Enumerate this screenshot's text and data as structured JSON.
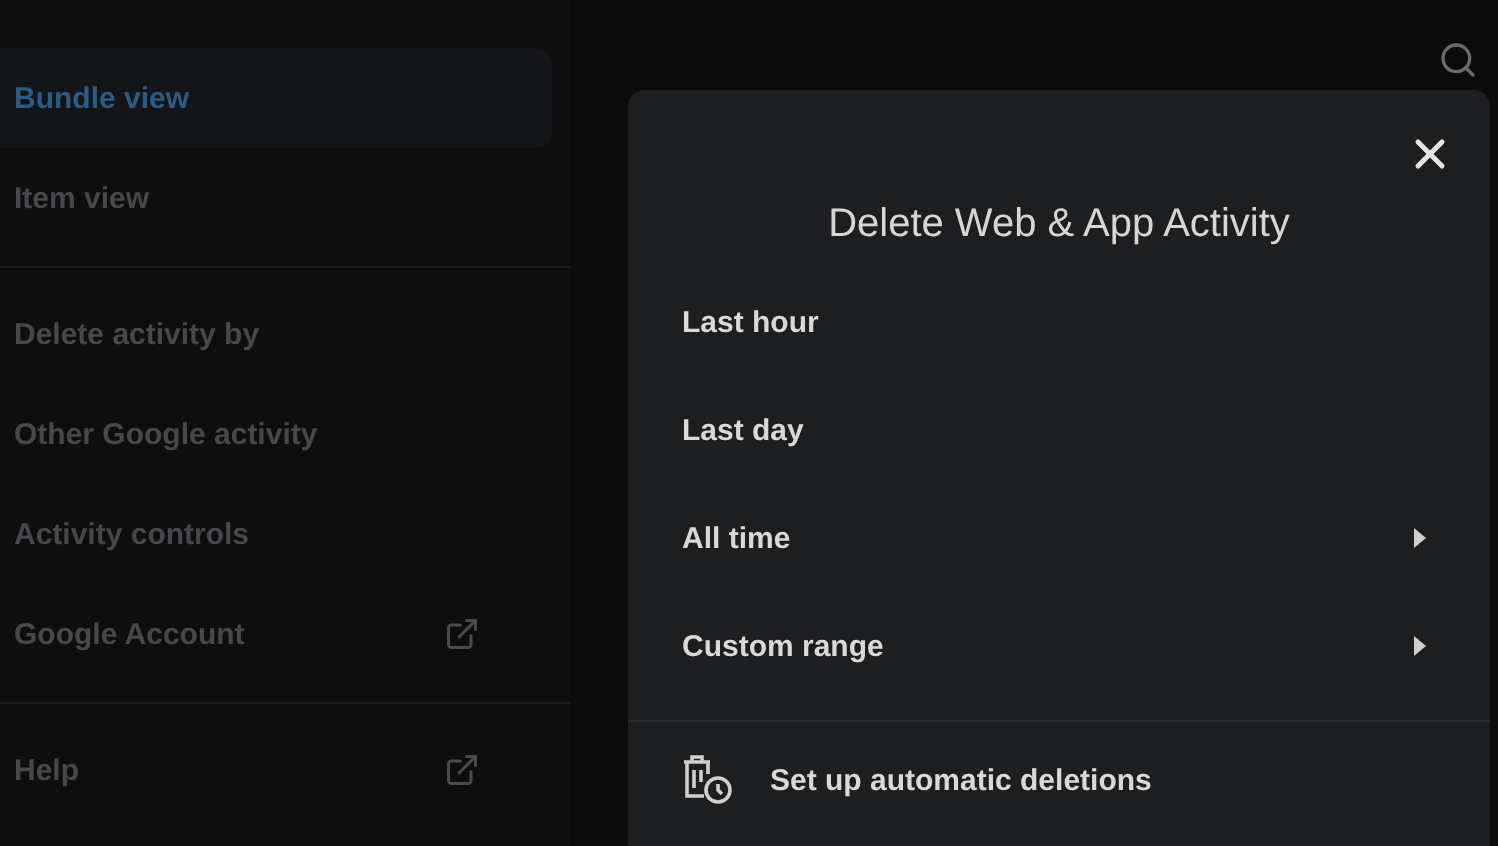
{
  "sidebar": {
    "sections": [
      {
        "items": [
          {
            "label": "Bundle view",
            "selected": true,
            "external": false
          },
          {
            "label": "Item view",
            "selected": false,
            "external": false
          }
        ]
      },
      {
        "items": [
          {
            "label": "Delete activity by",
            "selected": false,
            "external": false
          },
          {
            "label": "Other Google activity",
            "selected": false,
            "external": false
          },
          {
            "label": "Activity controls",
            "selected": false,
            "external": false
          },
          {
            "label": "Google Account",
            "selected": false,
            "external": true
          }
        ]
      },
      {
        "items": [
          {
            "label": "Help",
            "selected": false,
            "external": true
          }
        ]
      }
    ]
  },
  "dialog": {
    "title": "Delete Web & App Activity",
    "options": [
      {
        "label": "Last hour",
        "submenu": false
      },
      {
        "label": "Last day",
        "submenu": false
      },
      {
        "label": "All time",
        "submenu": true
      },
      {
        "label": "Custom range",
        "submenu": true
      }
    ],
    "footer_action": "Set up automatic deletions"
  }
}
